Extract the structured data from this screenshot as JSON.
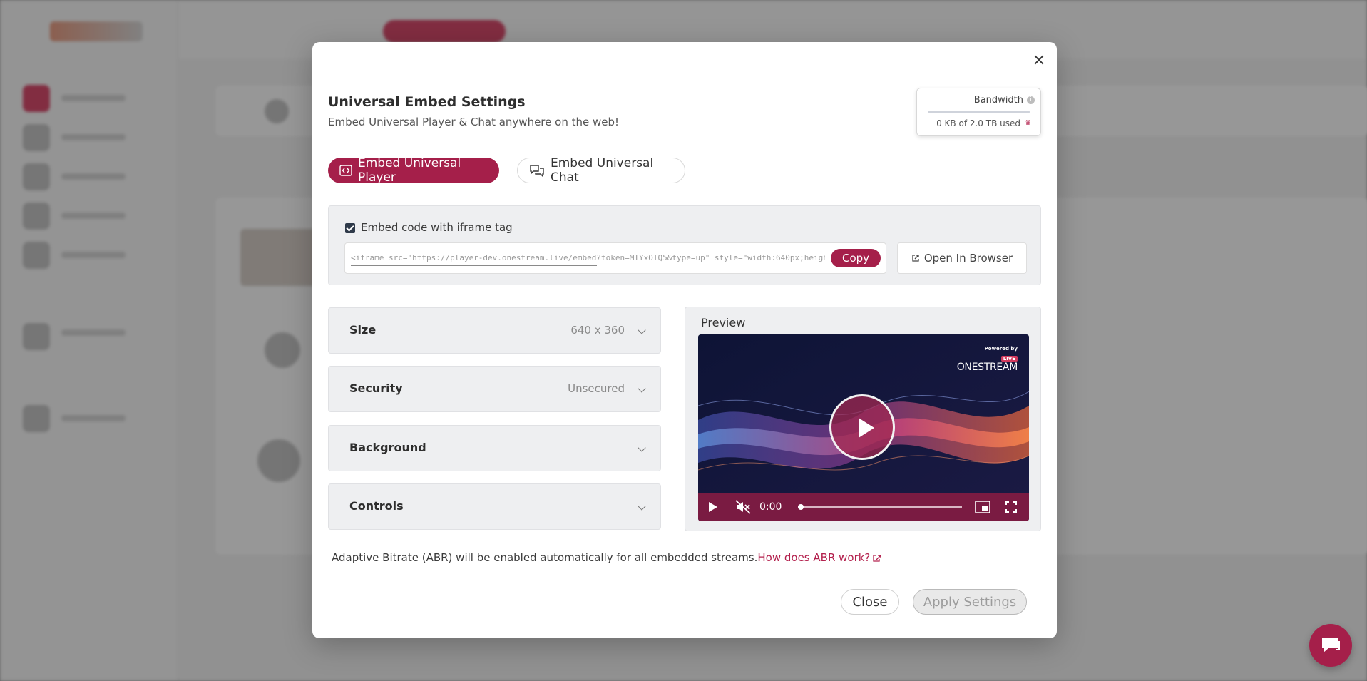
{
  "modal": {
    "title": "Universal Embed Settings",
    "subtitle": "Embed Universal Player & Chat anywhere on the web!",
    "bandwidth": {
      "label": "Bandwidth",
      "usage_text": "0 KB of 2.0 TB used",
      "used_fraction": 0
    },
    "tabs": [
      {
        "label": "Embed Universal Player",
        "icon": "embed-code-icon",
        "active": true
      },
      {
        "label": "Embed Universal Chat",
        "icon": "chat-bubbles-icon",
        "active": false
      }
    ],
    "embed": {
      "checkbox_label": "Embed code with iframe tag",
      "checked": true,
      "code": "<iframe src=\"https://player-dev.onestream.live/embed?token=MTYxOTQ5&type=up\" style=\"width:640px;heigh",
      "copy_label": "Copy",
      "open_label": "Open In Browser"
    },
    "settings": [
      {
        "title": "Size",
        "value": "640 x 360"
      },
      {
        "title": "Security",
        "value": "Unsecured"
      },
      {
        "title": "Background",
        "value": ""
      },
      {
        "title": "Controls",
        "value": ""
      }
    ],
    "preview": {
      "label": "Preview",
      "powered_by": "Powered by",
      "live_badge": "LIVE",
      "brand": "ONESTREAM",
      "time": "0:00"
    },
    "abr_text": "Adaptive Bitrate (ABR) will be enabled automatically for all embedded streams.",
    "abr_link": "How does ABR work?",
    "close_label": "Close",
    "apply_label": "Apply Settings"
  },
  "colors": {
    "brand": "#a51f4a",
    "panel": "#eeeff1"
  }
}
